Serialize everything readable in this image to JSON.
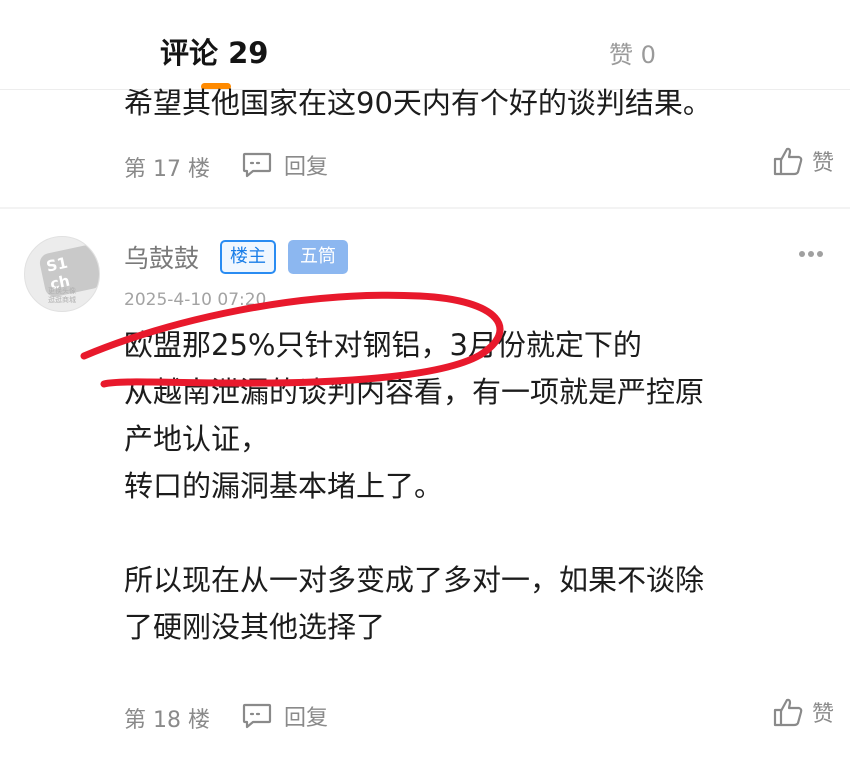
{
  "tabs": {
    "comments": "评论 29",
    "likes": "赞 0"
  },
  "comment_17": {
    "text": "希望其他国家在这90天内有个好的谈判结果。",
    "floor": "第 17 楼",
    "reply": "回复",
    "like": "赞"
  },
  "comment_18": {
    "username": "乌鼓鼓",
    "badge_op": "楼主",
    "badge_rank": "五筒",
    "timestamp": "2025-4-10 07:20",
    "avatar_logo": "S1 ch",
    "avatar_caption_1": "更换头像",
    "avatar_caption_2": "逛逛商城",
    "text": "欧盟那25%只针对钢铝，3月份就定下的\n从越南泄漏的谈判内容看，有一项就是严控原\n产地认证，\n转口的漏洞基本堵上了。\n\n所以现在从一对多变成了多对一，如果不谈除\n了硬刚没其他选择了",
    "floor": "第 18 楼",
    "reply": "回复",
    "like": "赞"
  },
  "colors": {
    "tab_indicator": "#ff8a00",
    "badge_op": "#2a8cf2",
    "badge_rank": "#8cb7f0",
    "annotation": "#e8192c"
  },
  "icons": {
    "reply": "comment-bubble-icon",
    "like": "thumbs-up-icon",
    "more": "more-dots-icon"
  }
}
